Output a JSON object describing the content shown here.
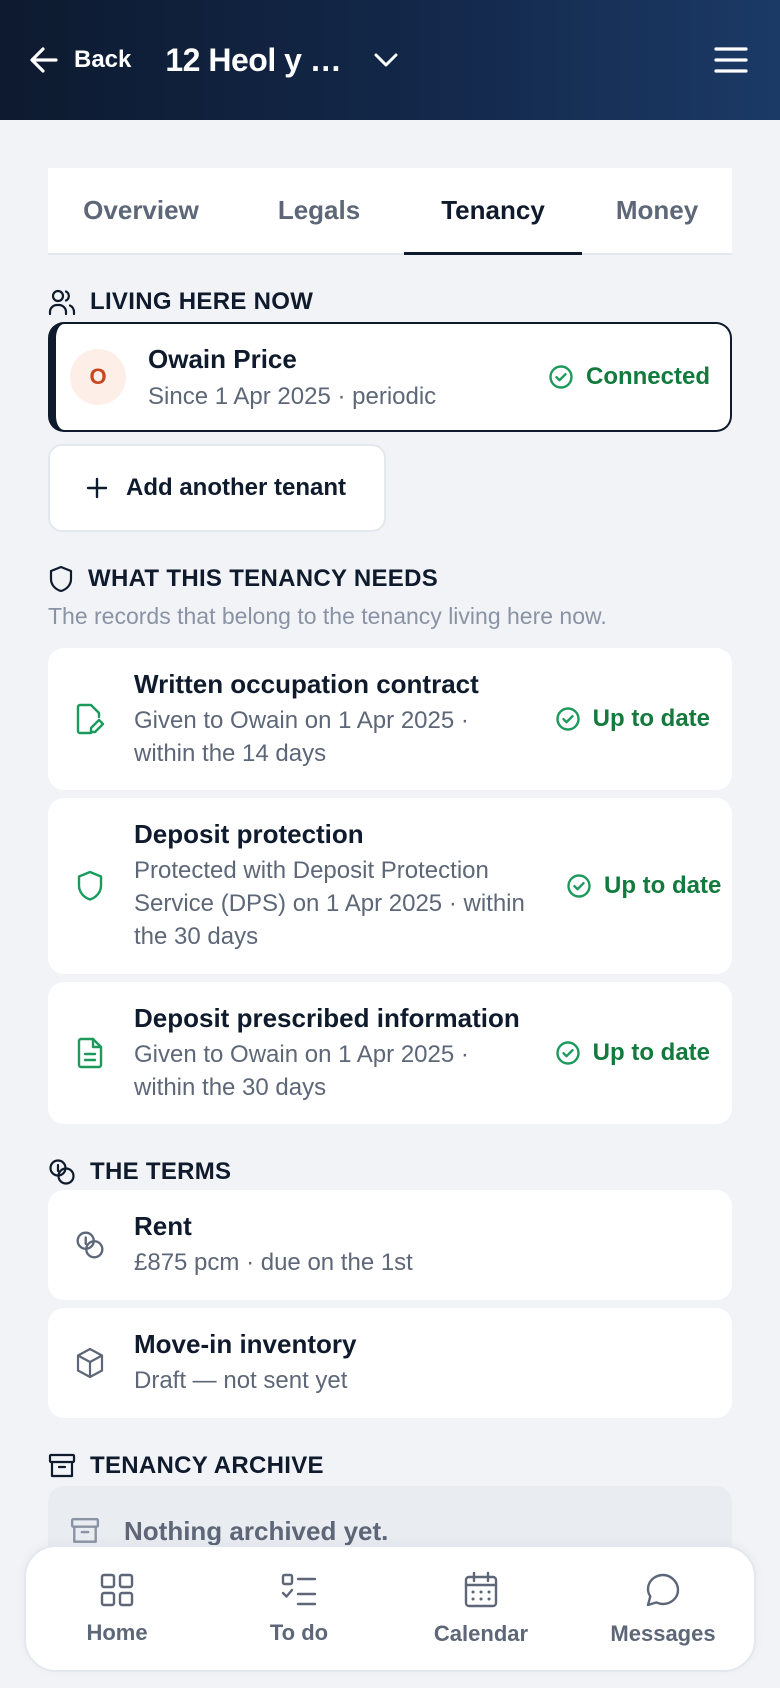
{
  "header": {
    "back_label": "Back",
    "title": "12 Heol y …",
    "icons": {
      "back": "arrow-left-icon",
      "dropdown": "chevron-down-icon",
      "menu": "hamburger-menu-icon"
    }
  },
  "tabs": [
    {
      "label": "Overview",
      "active": false
    },
    {
      "label": "Legals",
      "active": false
    },
    {
      "label": "Tenancy",
      "active": true
    },
    {
      "label": "Money",
      "active": false
    }
  ],
  "living_here": {
    "heading": "LIVING HERE NOW",
    "tenant": {
      "initial": "O",
      "name": "Owain Price",
      "since": "Since 1 Apr 2025 · periodic",
      "status": "Connected"
    },
    "add_label": "Add another tenant"
  },
  "needs": {
    "heading": "WHAT THIS TENANCY NEEDS",
    "subtitle": "The records that belong to the tenancy living here now.",
    "items": [
      {
        "title": "Written occupation contract",
        "desc": "Given to Owain on 1 Apr 2025 · within the 14 days",
        "status": "Up to date",
        "icon": "contract-edit-icon"
      },
      {
        "title": "Deposit protection",
        "desc": "Protected with Deposit Protection Service (DPS) on 1 Apr 2025 · within the 30 days",
        "status": "Up to date",
        "icon": "shield-icon"
      },
      {
        "title": "Deposit prescribed information",
        "desc": "Given to Owain on 1 Apr 2025 · within the 30 days",
        "status": "Up to date",
        "icon": "document-icon"
      }
    ]
  },
  "terms": {
    "heading": "THE TERMS",
    "items": [
      {
        "title": "Rent",
        "desc": "£875 pcm · due on the 1st",
        "icon": "coins-icon"
      },
      {
        "title": "Move-in inventory",
        "desc": "Draft — not sent yet",
        "icon": "box-icon"
      }
    ]
  },
  "archive": {
    "heading": "TENANCY ARCHIVE",
    "empty_text": "Nothing archived yet."
  },
  "bottom_nav": [
    {
      "label": "Home",
      "icon": "grid-icon"
    },
    {
      "label": "To do",
      "icon": "checklist-icon"
    },
    {
      "label": "Calendar",
      "icon": "calendar-icon"
    },
    {
      "label": "Messages",
      "icon": "chat-bubble-icon"
    }
  ],
  "colors": {
    "header_start": "#0d1a2f",
    "header_end": "#1b3a66",
    "success": "#137a3e",
    "icon_green": "#1b9a5c",
    "text_primary": "#0f1b2d",
    "text_secondary": "#5d6778",
    "background": "#f1f3f7"
  }
}
